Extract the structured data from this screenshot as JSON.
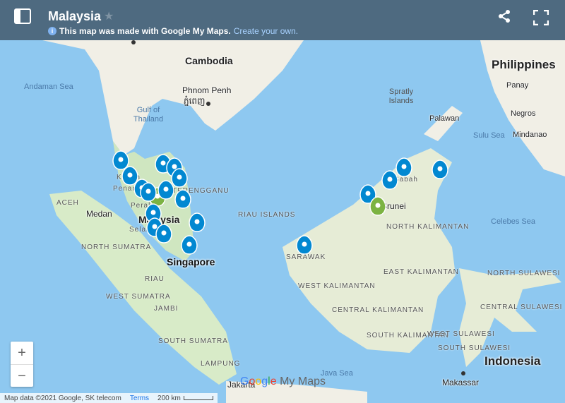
{
  "header": {
    "title": "Malaysia",
    "made_with": "This map was made with Google My Maps.",
    "create_link": "Create your own."
  },
  "labels": {
    "countries": [
      "Cambodia",
      "Philippines",
      "Malaysia",
      "Indonesia",
      "Singapore"
    ],
    "cities": [
      "Phnom Penh",
      "ភ្នំពេញ",
      "Medan",
      "Panay",
      "Negros",
      "Mindanao",
      "Palawan",
      "Jakarta",
      "Makassar",
      "Kedah",
      "Penang",
      "Perak",
      "Selangor",
      "Sabah",
      "Brunei"
    ],
    "regions": [
      "ACEH",
      "NORTH SUMATRA",
      "WEST SUMATRA",
      "RIAU",
      "JAMBI",
      "SOUTH SUMATRA",
      "LAMPUNG",
      "RIAU ISLANDS",
      "SARAWAK",
      "NORTH KALIMANTAN",
      "EAST KALIMANTAN",
      "WEST KALIMANTAN",
      "CENTRAL KALIMANTAN",
      "SOUTH KALIMANTAN",
      "NORTH SULAWESI",
      "CENTRAL SULAWESI",
      "WEST SULAWESI",
      "SOUTH SULAWESI",
      "TERENGGANU"
    ],
    "water": [
      "Andaman Sea",
      "Gulf of Thailand",
      "Spratly Islands",
      "Sulu Sea",
      "Celebes Sea",
      "Java Sea"
    ]
  },
  "markers": {
    "blue_count": 20,
    "green_count": 2,
    "colors": {
      "blue": "#0288d1",
      "green": "#7cb342"
    }
  },
  "controls": {
    "zoom_in": "+",
    "zoom_out": "−"
  },
  "footer": {
    "attribution": "Map data ©2021 Google, SK telecom",
    "terms": "Terms",
    "scale": "200 km"
  },
  "branding": {
    "my_maps": "My Maps"
  },
  "colors": {
    "header": "#4e6a80",
    "water": "#8ec8f0",
    "land": "#f1efe6",
    "forest": "#cfe6c0"
  }
}
